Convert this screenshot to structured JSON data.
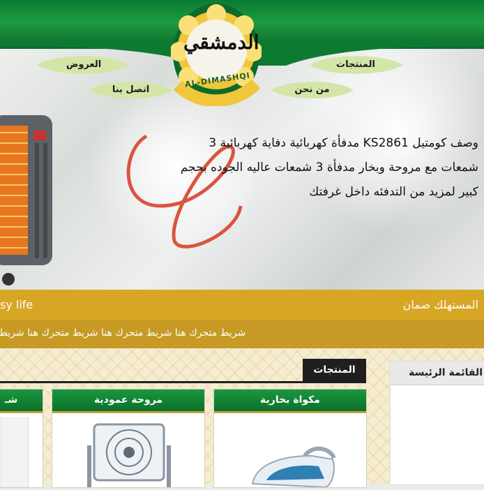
{
  "header": {
    "logo_arabic": "الدمشقي",
    "logo_latin": "AL-DIMASHQI",
    "nav": {
      "products": "المنتجات",
      "about": "من نحن",
      "offers": "العروض",
      "contact": "اتصل بنا"
    }
  },
  "hero": {
    "description_lines": [
      "وصف كومتيل KS2861 مدفأة كهربائية دفاية كهربائية 3",
      "شمعات مع مروحة وبخار مدفأة 3 شمعات عاليه الجوده بحجم",
      "كبير لمزيد من التدفئه داخل غرفتك"
    ]
  },
  "gold_bar": {
    "right_text": "المستهلك ضمان",
    "left_text": "sy life"
  },
  "ticker": {
    "text": "شريط متحرك هنا شريط متحرك هنا شريط متحرك هنا شريط"
  },
  "products_section": {
    "title": "المنتجات",
    "cards": [
      {
        "title": "مكواة بخارية",
        "icon": "steam-iron"
      },
      {
        "title": "مروحة عمودية",
        "icon": "box-fan"
      },
      {
        "title": "شـ",
        "icon": "product"
      }
    ]
  },
  "sidebar": {
    "title": "القائمة الرئيسة"
  },
  "colors": {
    "green": "#0d7a32",
    "gold": "#d8a625",
    "dark": "#1f1f1f"
  }
}
